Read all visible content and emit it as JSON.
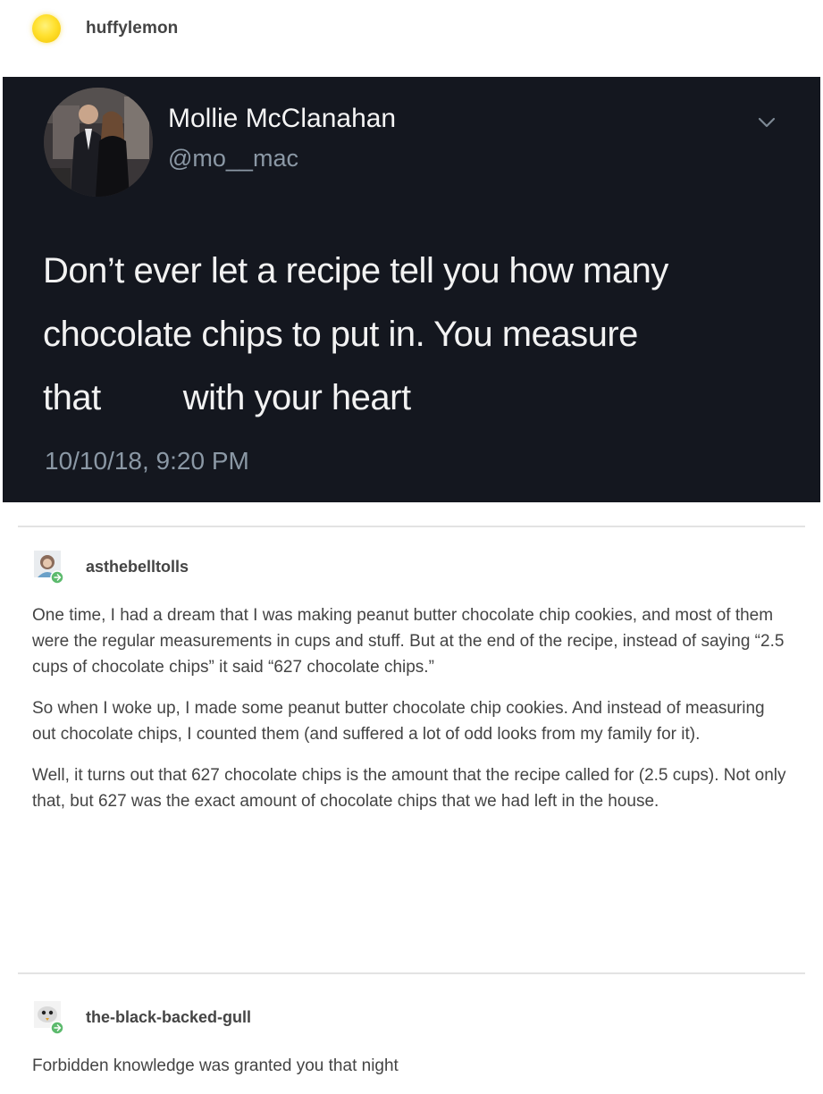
{
  "original_poster": {
    "username": "huffylemon"
  },
  "tweet": {
    "author_name": "Mollie McClanahan",
    "handle": "@mo__mac",
    "text_lines": [
      "Don’t ever let a recipe tell you how many",
      "chocolate chips to put in. You measure",
      [
        "that",
        "with your heart"
      ]
    ],
    "line1": "Don’t ever let a recipe tell you how many",
    "line2": "chocolate chips to put in. You measure",
    "line3a": "that",
    "line3b": "with your heart",
    "timestamp": "10/10/18, 9:20 PM",
    "menu_icon": "chevron-down-icon"
  },
  "reblogs": [
    {
      "username": "asthebelltolls",
      "paragraphs": [
        "One time, I had a dream that I was making peanut butter chocolate chip cookies, and most of them were the regular measurements in cups and stuff. But at the end of the recipe, instead of saying “2.5 cups of chocolate chips” it said “627 chocolate chips.”",
        "So when I woke up, I made some peanut butter chocolate chip cookies. And instead of measuring out chocolate chips, I counted them (and suffered a lot of odd looks from my family for it).",
        "Well, it turns out that 627 chocolate chips is the amount that the recipe called for (2.5 cups). Not only that, but 627 was the exact amount of chocolate chips that we had left in the house."
      ]
    },
    {
      "username": "the-black-backed-gull",
      "paragraphs": [
        "Forbidden knowledge was granted you that night"
      ]
    }
  ],
  "colors": {
    "tweet_background": "#14171f",
    "avatar_yellow": "#ffe02e",
    "reblog_badge_green": "#5cba6d"
  }
}
